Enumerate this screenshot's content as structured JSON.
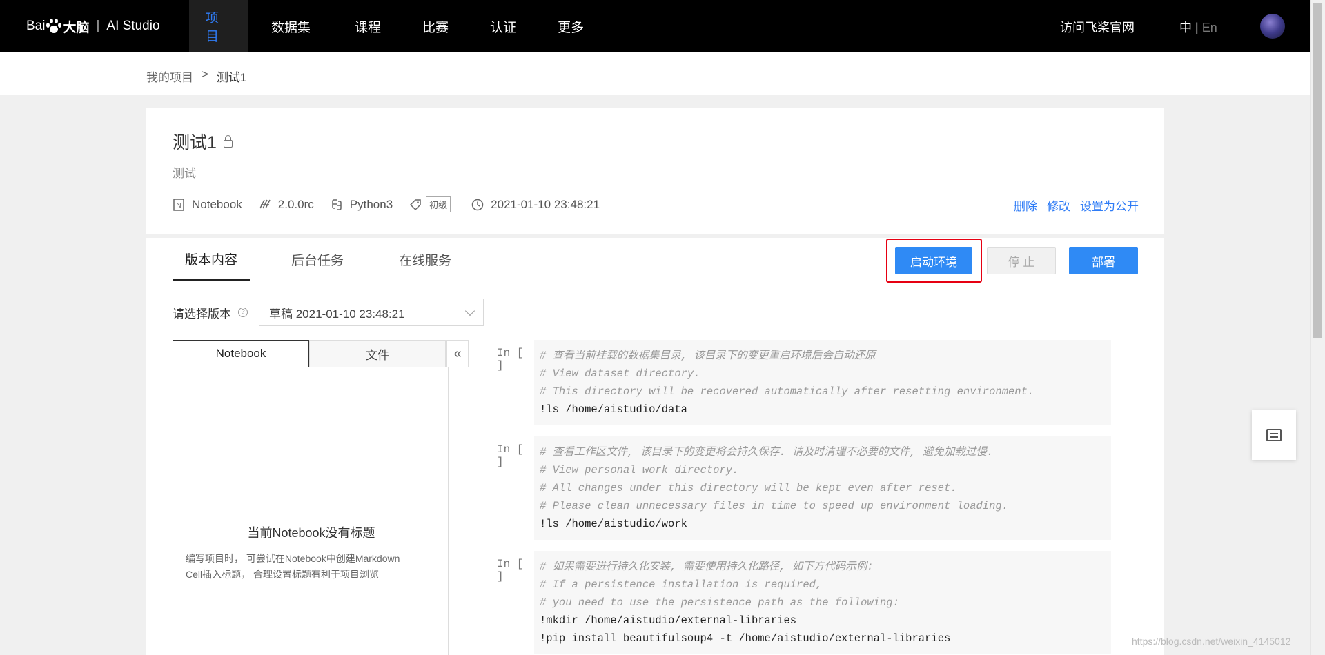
{
  "topnav": {
    "logo_text_left": "Bai",
    "logo_text_du": "du",
    "logo_text_brain": "大脑",
    "logo_text_sep": "|",
    "logo_text_product": "AI Studio",
    "items": [
      {
        "label": "项目",
        "active": true
      },
      {
        "label": "数据集"
      },
      {
        "label": "课程"
      },
      {
        "label": "比赛"
      },
      {
        "label": "认证"
      },
      {
        "label": "更多"
      }
    ],
    "official_site": "访问飞桨官网",
    "lang_zh": "中",
    "lang_sep": "|",
    "lang_en": "En"
  },
  "breadcrumb": {
    "root": "我的项目",
    "sep": ">",
    "current": "测试1"
  },
  "project": {
    "title": "测试1",
    "description": "测试",
    "type": "Notebook",
    "version": "2.0.0rc",
    "language": "Python3",
    "level": "初级",
    "datetime": "2021-01-10 23:48:21",
    "actions": {
      "delete": "删除",
      "edit": "修改",
      "make_public": "设置为公开"
    }
  },
  "tabs": [
    {
      "label": "版本内容",
      "active": true
    },
    {
      "label": "后台任务"
    },
    {
      "label": "在线服务"
    }
  ],
  "buttons": {
    "start": "启动环境",
    "stop": "停 止",
    "deploy": "部署"
  },
  "version_select": {
    "label": "请选择版本",
    "value": "草稿 2021-01-10 23:48:21"
  },
  "toc": {
    "tab_notebook": "Notebook",
    "tab_files": "文件",
    "collapse": "«",
    "empty_title": "当前Notebook没有标题",
    "empty_desc_1": "编写项目时， 可尝试在Notebook中创建Markdown",
    "empty_desc_2": "Cell插入标题， 合理设置标题有利于项目浏览"
  },
  "cells": [
    {
      "prompt": "In [ ]",
      "lines": [
        {
          "comment": true,
          "text": "# 查看当前挂载的数据集目录, 该目录下的变更重启环境后会自动还原"
        },
        {
          "comment": true,
          "text": "# View dataset directory."
        },
        {
          "comment": true,
          "text": "# This directory will be recovered automatically after resetting environment."
        },
        {
          "comment": false,
          "text": "!ls /home/aistudio/data"
        }
      ]
    },
    {
      "prompt": "In [ ]",
      "lines": [
        {
          "comment": true,
          "text": "# 查看工作区文件, 该目录下的变更将会持久保存. 请及时清理不必要的文件, 避免加载过慢."
        },
        {
          "comment": true,
          "text": "# View personal work directory."
        },
        {
          "comment": true,
          "text": "# All changes under this directory will be kept even after reset."
        },
        {
          "comment": true,
          "text": "# Please clean unnecessary files in time to speed up environment loading."
        },
        {
          "comment": false,
          "text": "!ls /home/aistudio/work"
        }
      ]
    },
    {
      "prompt": "In [ ]",
      "lines": [
        {
          "comment": true,
          "text": "# 如果需要进行持久化安装, 需要使用持久化路径, 如下方代码示例:"
        },
        {
          "comment": true,
          "text": "# If a persistence installation is required,"
        },
        {
          "comment": true,
          "text": "# you need to use the persistence path as the following:"
        },
        {
          "comment": false,
          "text": "!mkdir /home/aistudio/external-libraries"
        },
        {
          "comment": false,
          "text": "!pip install beautifulsoup4 -t /home/aistudio/external-libraries"
        }
      ]
    }
  ],
  "watermark": "https://blog.csdn.net/weixin_4145012"
}
